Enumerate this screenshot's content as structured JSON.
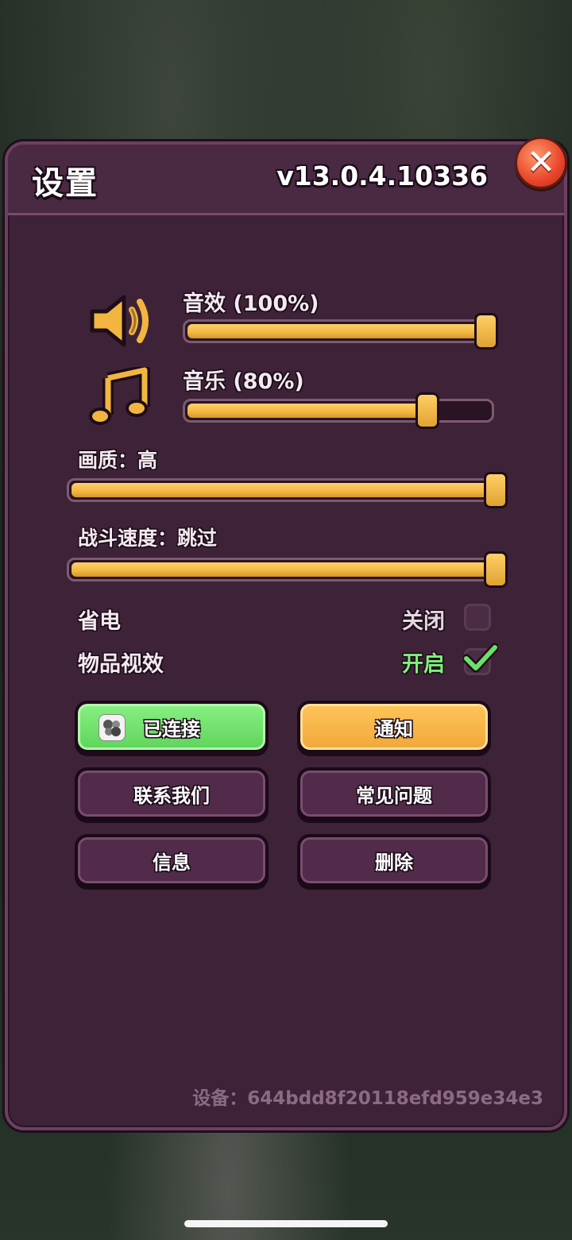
{
  "header": {
    "title": "设置",
    "version": "v13.0.4.10336",
    "close_icon": "close-x-icon"
  },
  "audio": {
    "sound_label": "音效 (100%)",
    "sound_value": 1.0,
    "sound_icon": "speaker-icon",
    "music_label": "音乐 (80%)",
    "music_value": 0.8,
    "music_icon": "music-note-icon"
  },
  "quality": {
    "label": "画质：高",
    "value": 1.0
  },
  "battle_speed": {
    "label": "战斗速度：跳过",
    "value": 1.0
  },
  "toggles": [
    {
      "label": "省电",
      "state_text": "关闭",
      "checked": false,
      "state_color": "#e3d6df"
    },
    {
      "label": "物品视效",
      "state_text": "开启",
      "checked": true,
      "state_color": "#7ef07a"
    }
  ],
  "buttons": {
    "connected": "已连接",
    "notify": "通知",
    "contact": "联系我们",
    "faq": "常见问题",
    "info": "信息",
    "delete": "删除"
  },
  "footer": {
    "device": "设备：644bdd8f20118efd959e34e3"
  },
  "colors": {
    "panel_bg": "#3e2338",
    "slider_fill": "#f2b640",
    "accent_green": "#6be067",
    "accent_orange": "#f5b547",
    "close_red": "#e8452a"
  }
}
